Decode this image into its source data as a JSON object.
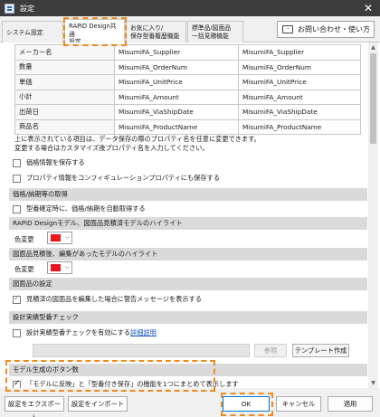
{
  "window": {
    "title": "設定",
    "close_glyph": "✕"
  },
  "tabs": [
    {
      "line1": "システム設定",
      "line2": ""
    },
    {
      "line1": "RAPiD Design共通",
      "line2": "設定"
    },
    {
      "line1": "お気に入り/",
      "line2": "保存型番履歴機能"
    },
    {
      "line1": "標準品/図面品",
      "line2": "一括見積機能"
    }
  ],
  "contact_button": {
    "label": "お問い合わせ・使い方",
    "icon": "chat-icon",
    "icon_text": "..."
  },
  "property_table": {
    "rows": [
      [
        "メーカー名",
        "MisumiFA_Supplier",
        "MisumiFA_Supplier"
      ],
      [
        "数量",
        "MisumiFA_OrderNum",
        "MisumiFA_OrderNum"
      ],
      [
        "単価",
        "MisumiFA_UnitPrice",
        "MisumiFA_UnitPrice"
      ],
      [
        "小計",
        "MisumiFA_Amount",
        "MisumiFA_Amount"
      ],
      [
        "出荷日",
        "MisumiFA_ViaShipDate",
        "MisumiFA_ViaShipDate"
      ],
      [
        "商品名",
        "MisumiFA_ProductName",
        "MisumiFA_ProductName"
      ]
    ]
  },
  "notes": {
    "line1": "上に表示されている項目は、データ保存の際のプロパティ名を任意に変更できます。",
    "line2": "変更する場合はカスタマイズ後プロパティ名を入力してください。"
  },
  "checkboxes": {
    "save_price": {
      "label": "価格情報を保存する",
      "checked": false
    },
    "save_config": {
      "label": "プロパティ情報をコンフィギュレーションプロパティにも保存する",
      "checked": false
    },
    "auto_fetch": {
      "label": "型番確定時に、価格/納期を自動取得する",
      "checked": false
    },
    "warn_edit": {
      "label": "見積済の図面品を編集した場合に警告メッセージを表示する",
      "checked": true
    },
    "enable_check": {
      "label": "設計実績型番チェックを有効にする",
      "checked": false
    },
    "combine_buttons": {
      "label": "「モデルに反映」と「型番付き保存」の機能を1つにまとめて表示します",
      "checked": true
    }
  },
  "sections": {
    "price_fetch": "価格/納期等の取得",
    "highlight_quoted": "RAPiD Designモデル、図面品見積済モデルのハイライト",
    "highlight_edited": "図面品見積後、編集があったモデルのハイライト",
    "drawing_settings": "図面品の設定",
    "design_check": "設計実績型番チェック",
    "button_count": "モデル生成のボタン数"
  },
  "color_change": {
    "label": "色変更",
    "swatch": "#e8171f",
    "dropdown_glyph": "⌵"
  },
  "links": {
    "details": "詳細説明"
  },
  "buttons": {
    "browse": "参照",
    "template": "テンプレート作成",
    "export": "設定をエクスポート",
    "import": "設定をインポート",
    "ok": "OK",
    "cancel": "キャンセル",
    "apply": "適用"
  },
  "scrollbar": {
    "up_glyph": "▲",
    "down_glyph": "▼"
  }
}
